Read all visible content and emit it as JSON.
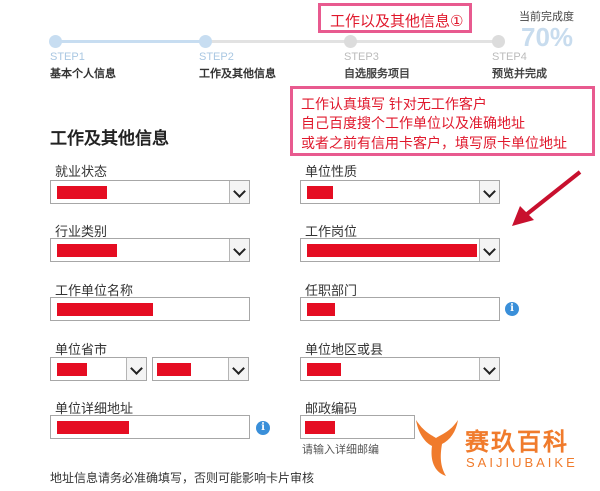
{
  "annotations": {
    "top": "工作以及其他信息①",
    "box_lines": [
      "工作认真填写 针对无工作客户",
      "自己百度搜个工作单位以及准确地址",
      "或者之前有信用卡客户，填写原卡单位地址"
    ]
  },
  "progress": {
    "label": "当前完成度",
    "value": "70%",
    "fraction": 0.7
  },
  "steps": [
    {
      "num": "STEP1",
      "name": "基本个人信息"
    },
    {
      "num": "STEP2",
      "name": "工作及其他信息"
    },
    {
      "num": "STEP3",
      "name": "自选服务项目"
    },
    {
      "num": "STEP4",
      "name": "预览并完成"
    }
  ],
  "section_title": "工作及其他信息",
  "fields": {
    "employment_status": {
      "label": "就业状态",
      "value": ""
    },
    "unit_nature": {
      "label": "单位性质",
      "value": ""
    },
    "industry": {
      "label": "行业类别",
      "value": ""
    },
    "position": {
      "label": "工作岗位",
      "value": ""
    },
    "company_name": {
      "label": "工作单位名称",
      "value": ""
    },
    "department": {
      "label": "任职部门",
      "value": ""
    },
    "province_city": {
      "label": "单位省市",
      "province": "",
      "city": ""
    },
    "district": {
      "label": "单位地区或县",
      "value": ""
    },
    "address": {
      "label": "单位详细地址",
      "value": ""
    },
    "postcode": {
      "label": "邮政编码",
      "value": "",
      "hint": "请输入详细邮编"
    }
  },
  "footer_note": "地址信息请务必准确填写，否则可能影响卡片审核",
  "watermark": {
    "title": "赛玖百科",
    "subtitle": "SAIJIUBAIKE"
  },
  "colors": {
    "accent": "#e0182c",
    "annotation_border": "#e85a8f",
    "step_active": "#2f7fd6",
    "step_done": "#b8d5ef",
    "watermark": "#f07b2c"
  }
}
